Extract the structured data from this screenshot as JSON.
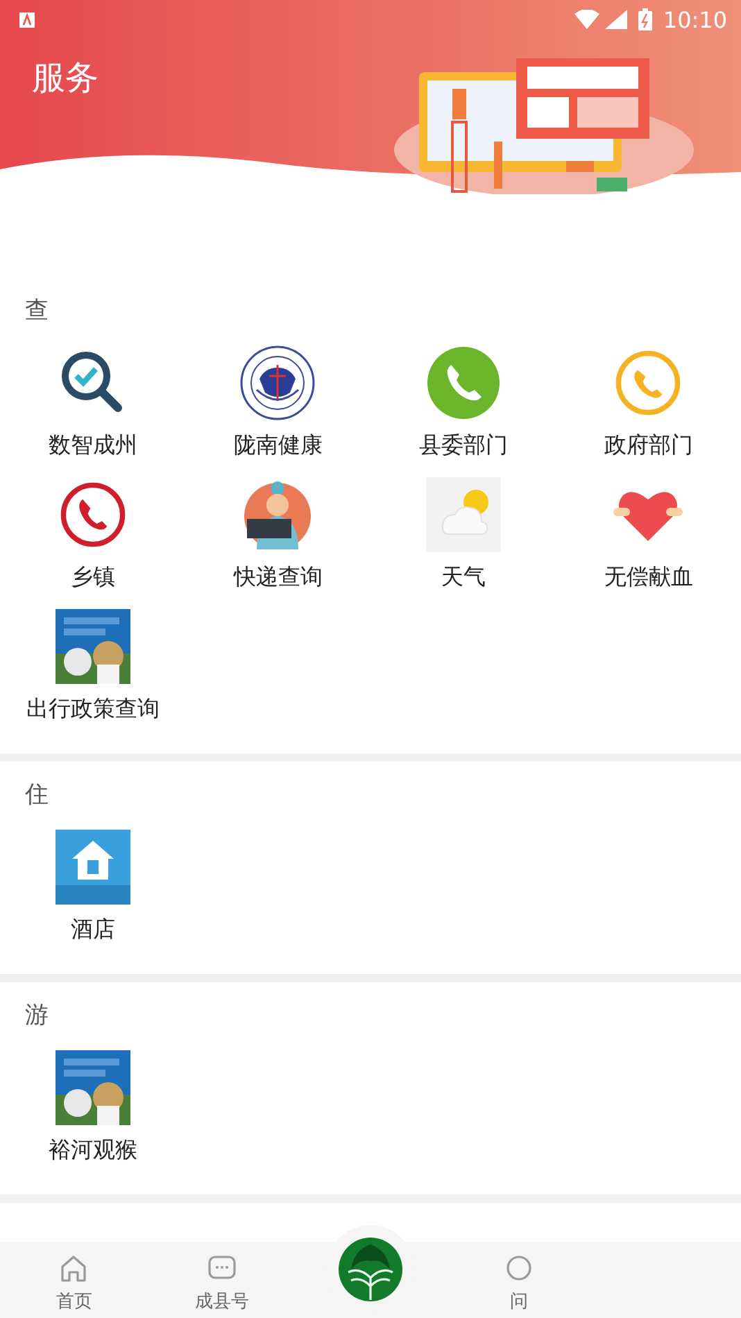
{
  "status_bar": {
    "time": "10:10"
  },
  "header": {
    "title": "服务"
  },
  "sections": [
    {
      "title": "查",
      "items": [
        {
          "label": "数智成州",
          "kind": "search-check"
        },
        {
          "label": "陇南健康",
          "kind": "emblem"
        },
        {
          "label": "县委部门",
          "kind": "phone-green"
        },
        {
          "label": "政府部门",
          "kind": "phone-yellow"
        },
        {
          "label": "乡镇",
          "kind": "phone-red"
        },
        {
          "label": "快递查询",
          "kind": "courier"
        },
        {
          "label": "天气",
          "kind": "weather"
        },
        {
          "label": "无偿献血",
          "kind": "heart"
        },
        {
          "label": "出行政策查询",
          "kind": "picture"
        }
      ]
    },
    {
      "title": "住",
      "items": [
        {
          "label": "酒店",
          "kind": "hotel"
        }
      ]
    },
    {
      "title": "游",
      "items": [
        {
          "label": "裕河观猴",
          "kind": "picture"
        }
      ]
    }
  ],
  "tab_bar": [
    {
      "label": "首页",
      "kind": "home"
    },
    {
      "label": "成县号",
      "kind": "chat"
    },
    {
      "kind": "logo"
    },
    {
      "label": "问",
      "kind": "question"
    }
  ]
}
